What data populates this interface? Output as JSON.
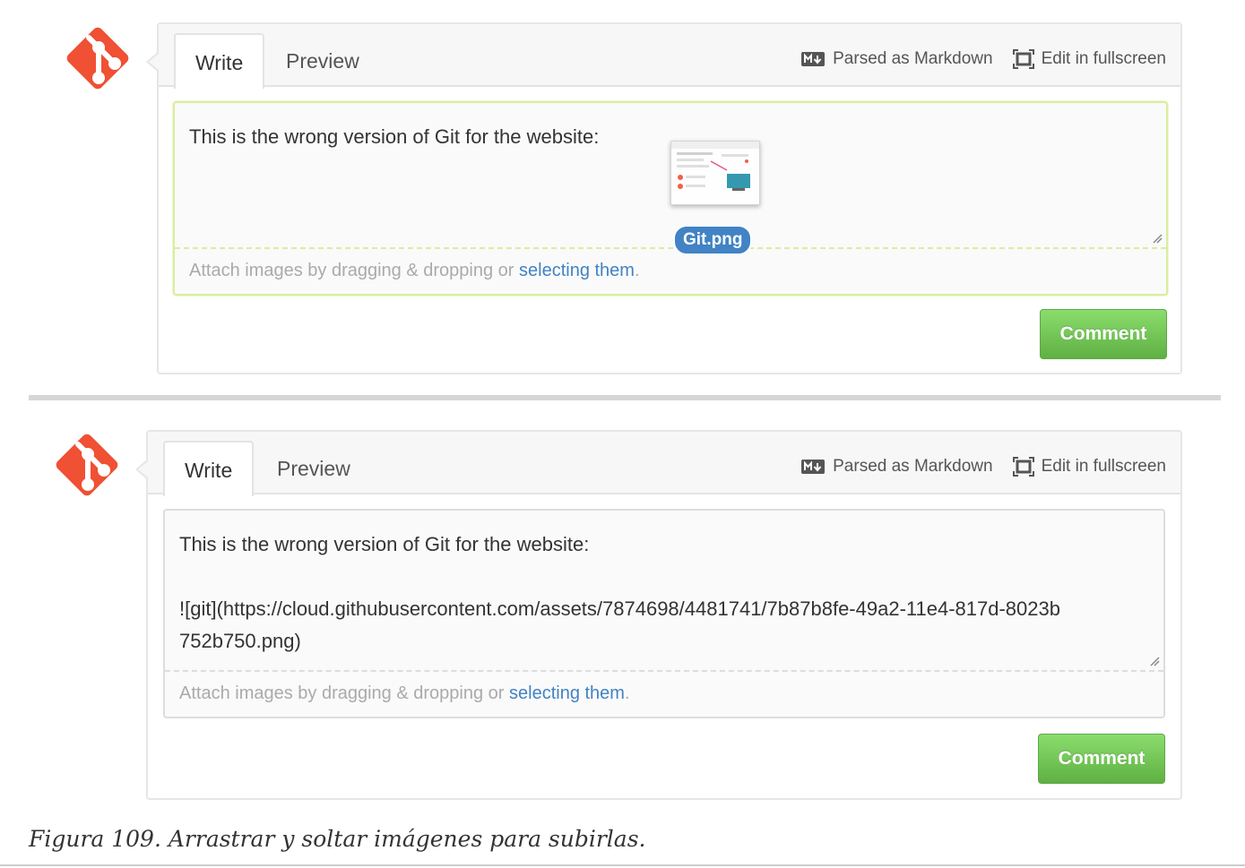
{
  "panels": [
    {
      "tabs": {
        "write": "Write",
        "preview": "Preview"
      },
      "tools": {
        "markdown": "Parsed as Markdown",
        "fullscreen": "Edit in fullscreen"
      },
      "editor_text": "This is the wrong version of Git for the website:",
      "drag_file": "Git.png",
      "attach": {
        "prefix": "Attach images by dragging & dropping or ",
        "link": "selecting them",
        "suffix": "."
      },
      "comment_label": "Comment"
    },
    {
      "tabs": {
        "write": "Write",
        "preview": "Preview"
      },
      "tools": {
        "markdown": "Parsed as Markdown",
        "fullscreen": "Edit in fullscreen"
      },
      "editor_text": "This is the wrong version of Git for the website:\n\n![git](https://cloud.githubusercontent.com/assets/7874698/4481741/7b87b8fe-49a2-11e4-817d-8023b752b750.png)",
      "attach": {
        "prefix": "Attach images by dragging & dropping or ",
        "link": "selecting them",
        "suffix": "."
      },
      "comment_label": "Comment"
    }
  ],
  "caption": "Figura 109. Arrastrar y soltar imágenes para subirlas.",
  "colors": {
    "git_logo": "#f05033",
    "link": "#4183c4",
    "comment_button": "#60b044",
    "drag_highlight": "#d9eea0"
  },
  "icons": [
    "git-logo-icon",
    "markdown-icon",
    "fullscreen-icon",
    "resize-grip-icon"
  ]
}
